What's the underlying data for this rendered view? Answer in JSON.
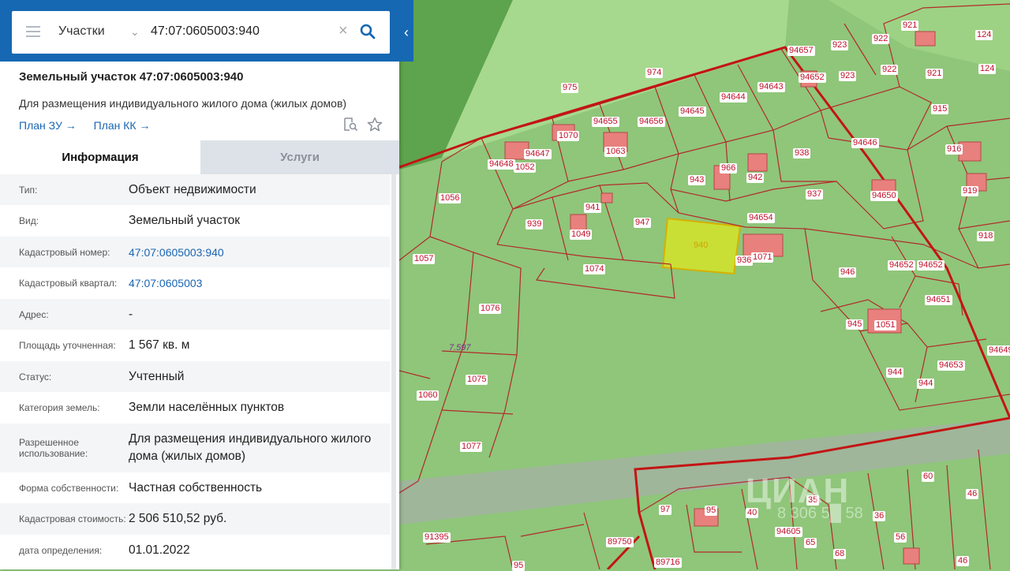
{
  "search": {
    "layer": "Участки",
    "query": "47:07:0605003:940"
  },
  "parcel": {
    "title": "Земельный участок 47:07:0605003:940",
    "purpose": "Для размещения индивидуального жилого дома (жилых домов)",
    "plan_zu": "План ЗУ →",
    "plan_kk": "План КК →"
  },
  "tabs": {
    "info": "Информация",
    "services": "Услуги"
  },
  "info_rows": [
    {
      "key": "Тип:",
      "value": "Объект недвижимости"
    },
    {
      "key": "Вид:",
      "value": "Земельный участок"
    },
    {
      "key": "Кадастровый номер:",
      "value": "47:07:0605003:940"
    },
    {
      "key": "Кадастровый квартал:",
      "value": "47:07:0605003"
    },
    {
      "key": "Адрес:",
      "value": "-"
    },
    {
      "key": "Площадь уточненная:",
      "value": "1 567 кв. м"
    },
    {
      "key": "Статус:",
      "value": "Учтенный"
    },
    {
      "key": "Категория земель:",
      "value": "Земли населённых пунктов"
    },
    {
      "key": "Разрешенное использование:",
      "value": "Для размещения индивидуального жилого дома (жилых домов)"
    },
    {
      "key": "Форма собственности:",
      "value": "Частная собственность"
    },
    {
      "key": "Кадастровая стоимость:",
      "value": "2 506 510,52 руб."
    },
    {
      "key": "дата определения:",
      "value": "01.01.2022"
    }
  ],
  "map": {
    "labels": [
      "975",
      "974",
      "94657",
      "923",
      "922",
      "921",
      "124",
      "94652",
      "923",
      "922",
      "921",
      "124",
      "94655",
      "94656",
      "94645",
      "94644",
      "94643",
      "915",
      "1070",
      "1063",
      "94647",
      "94648",
      "1052",
      "94646",
      "916",
      "938",
      "943",
      "966",
      "942",
      "937",
      "94650",
      "919",
      "1056",
      "941",
      "947",
      "939",
      "1049",
      "94654",
      "918",
      "940",
      "936",
      "1071",
      "1057",
      "1074",
      "946",
      "94652",
      "94652",
      "1076",
      "94651",
      "945",
      "1051",
      "7.597",
      "94649",
      "1075",
      "944",
      "944",
      "94653",
      "1060",
      "1077",
      "97",
      "95",
      "40",
      "35",
      "36",
      "56",
      "60",
      "46",
      "91395",
      "89750",
      "89716",
      "95",
      "65",
      "94605",
      "68",
      "46"
    ],
    "watermark": "ЦИАН",
    "watermark_phone": "8 306 5█ 58"
  }
}
